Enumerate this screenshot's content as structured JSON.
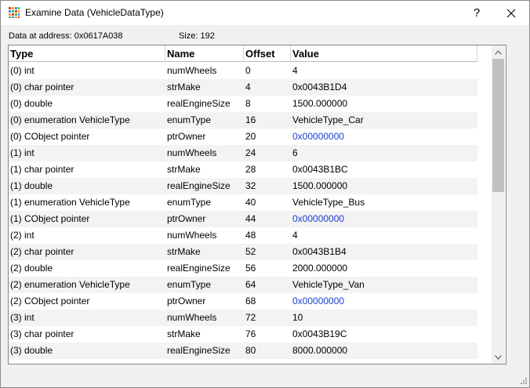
{
  "window": {
    "title": "Examine Data (VehicleDataType)",
    "help_label": "?",
    "close_label": "✕"
  },
  "info": {
    "address": "Data at address:  0x0617A038",
    "size": "Size:  192"
  },
  "columns": [
    "Type",
    "Name",
    "Offset",
    "Value"
  ],
  "rows": [
    {
      "type": "(0) int",
      "name": "numWheels",
      "offset": "0",
      "value": "4"
    },
    {
      "type": "(0) char pointer",
      "name": "strMake",
      "offset": "4",
      "value": "0x0043B1D4"
    },
    {
      "type": "(0) double",
      "name": "realEngineSize",
      "offset": "8",
      "value": "1500.000000"
    },
    {
      "type": "(0) enumeration VehicleType",
      "name": "enumType",
      "offset": "16",
      "value": "VehicleType_Car"
    },
    {
      "type": "(0) CObject pointer",
      "name": "ptrOwner",
      "offset": "20",
      "value": "0x00000000"
    },
    {
      "type": "(1) int",
      "name": "numWheels",
      "offset": "24",
      "value": "6"
    },
    {
      "type": "(1) char pointer",
      "name": "strMake",
      "offset": "28",
      "value": "0x0043B1BC"
    },
    {
      "type": "(1) double",
      "name": "realEngineSize",
      "offset": "32",
      "value": "1500.000000"
    },
    {
      "type": "(1) enumeration VehicleType",
      "name": "enumType",
      "offset": "40",
      "value": "VehicleType_Bus"
    },
    {
      "type": "(1) CObject pointer",
      "name": "ptrOwner",
      "offset": "44",
      "value": "0x00000000"
    },
    {
      "type": "(2) int",
      "name": "numWheels",
      "offset": "48",
      "value": "4"
    },
    {
      "type": "(2) char pointer",
      "name": "strMake",
      "offset": "52",
      "value": "0x0043B1B4"
    },
    {
      "type": "(2) double",
      "name": "realEngineSize",
      "offset": "56",
      "value": "2000.000000"
    },
    {
      "type": "(2) enumeration VehicleType",
      "name": "enumType",
      "offset": "64",
      "value": "VehicleType_Van"
    },
    {
      "type": "(2) CObject pointer",
      "name": "ptrOwner",
      "offset": "68",
      "value": "0x00000000"
    },
    {
      "type": "(3) int",
      "name": "numWheels",
      "offset": "72",
      "value": "10"
    },
    {
      "type": "(3) char pointer",
      "name": "strMake",
      "offset": "76",
      "value": "0x0043B19C"
    },
    {
      "type": "(3) double",
      "name": "realEngineSize",
      "offset": "80",
      "value": "8000.000000"
    }
  ],
  "colors": {
    "link": "#1b3fd0",
    "alt_row": "#f3f3f3"
  }
}
